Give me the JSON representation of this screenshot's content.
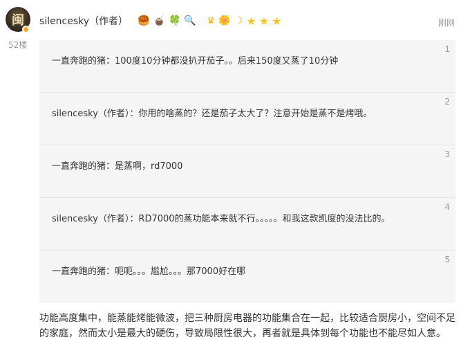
{
  "comment": {
    "author": "silencesky（作者）",
    "floor": "52楼",
    "time": "刚刚",
    "badges": [
      "🥮",
      "🧉",
      "🍀",
      "🔍",
      "♛",
      "🌼",
      "☽",
      "★",
      "★",
      "★"
    ],
    "body": "功能高度集中，能蒸能烤能微波，把三种厨房电器的功能集合在一起，比较适合厨房小，空间不足的家庭，然而太小是最大的硬伤，导致局限性很大，再者就是具体到每个功能也不能尽如人意。"
  },
  "replies": [
    {
      "text": "一直奔跑的猪：100度10分钟都没扒开茄子。。后来150度又蒸了10分钟",
      "index": "1"
    },
    {
      "text": "silencesky（作者）：你用的啥蒸的？还是茄子太大了？注意开始是蒸不是烤哦。",
      "index": "2"
    },
    {
      "text": "一直奔跑的猪：是蒸啊，rd7000",
      "index": "3"
    },
    {
      "text": "silencesky（作者）：RD7000的蒸功能本来就不行。。。。。和我这款凯度的没法比的。",
      "index": "4"
    },
    {
      "text": "一直奔跑的猪：呃呃。。。尴尬。。。那7000好在哪",
      "index": "5"
    }
  ]
}
